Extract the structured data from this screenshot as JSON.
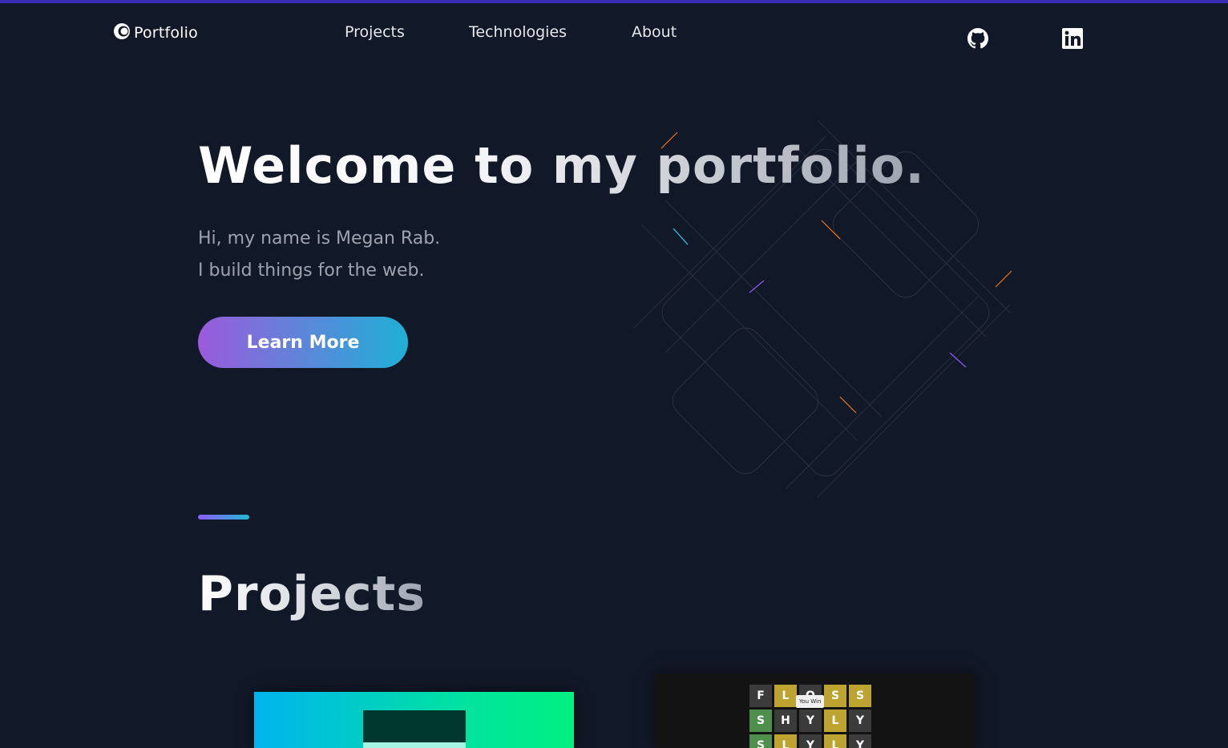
{
  "colors": {
    "background": "#111827",
    "accent_start": "#9b5bdb",
    "accent_end": "#1fb0d6",
    "top_bar": "#3b2fb5"
  },
  "header": {
    "logo": {
      "icon": "circle-logo-icon",
      "text": "Portfolio"
    },
    "nav": [
      {
        "label": "Projects"
      },
      {
        "label": "Technologies"
      },
      {
        "label": "About"
      }
    ],
    "social": [
      {
        "icon": "github-icon"
      },
      {
        "icon": "linkedin-icon"
      }
    ]
  },
  "hero": {
    "title": "Welcome to my portfolio.",
    "lines": [
      "Hi, my name is Megan Rab.",
      "I build things for the web."
    ],
    "cta_label": "Learn More"
  },
  "projects": {
    "title": "Projects",
    "cards": [
      {
        "name": "project-card-1",
        "theme": "gradient-dashboard"
      },
      {
        "name": "project-card-2",
        "theme": "word-game",
        "tiles": [
          [
            "F",
            "L",
            "O",
            "S",
            "S"
          ],
          [
            "S",
            "H",
            "Y",
            "L",
            "Y"
          ],
          [
            "S",
            "L",
            "Y",
            "L",
            "Y"
          ]
        ],
        "tile_colors": [
          [
            "d",
            "y",
            "d",
            "y",
            "y"
          ],
          [
            "g",
            "d",
            "d",
            "y",
            "d"
          ],
          [
            "g",
            "y",
            "d",
            "y",
            "d"
          ]
        ],
        "popup": "You Win"
      }
    ]
  }
}
